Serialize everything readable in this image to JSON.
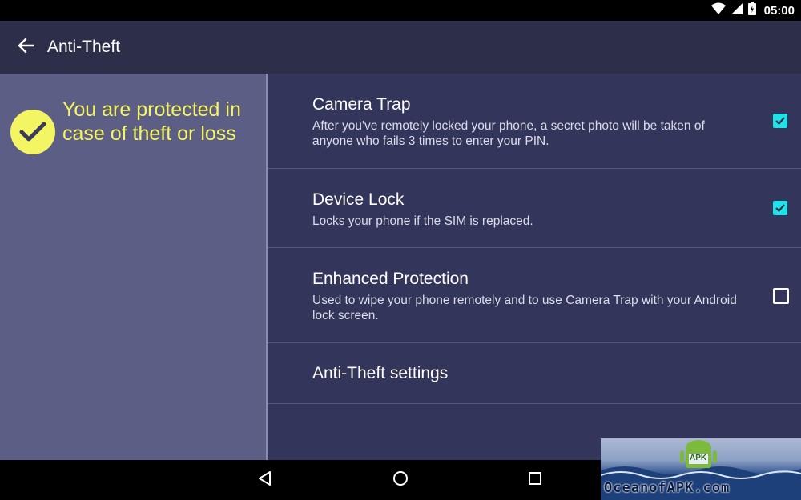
{
  "status_bar": {
    "time": "05:00",
    "icons": [
      "wifi-icon",
      "signal-icon",
      "battery-icon"
    ]
  },
  "app_bar": {
    "title": "Anti-Theft",
    "back_icon": "arrow-left-icon"
  },
  "left_panel": {
    "status_text": "You are protected in case of theft or loss",
    "status_icon": "check-circle-icon",
    "accent": "#f4f562"
  },
  "settings": {
    "items": [
      {
        "title": "Camera Trap",
        "description": "After you've remotely locked your phone, a secret photo will be taken of anyone who fails 3 times to enter your PIN.",
        "checked": true
      },
      {
        "title": "Device Lock",
        "description": "Locks your phone if the SIM is replaced.",
        "checked": true
      },
      {
        "title": "Enhanced Protection",
        "description": "Used to wipe your phone remotely and to use Camera Trap with your Android lock screen.",
        "checked": false
      },
      {
        "title": "Anti-Theft settings"
      }
    ],
    "checkbox_color": "#1fe3e8"
  },
  "nav_bar": {
    "buttons": [
      "back-triangle-icon",
      "home-circle-icon",
      "recents-square-icon"
    ]
  },
  "watermark": {
    "text": "OceanofAPK.com",
    "badge": "APK"
  }
}
